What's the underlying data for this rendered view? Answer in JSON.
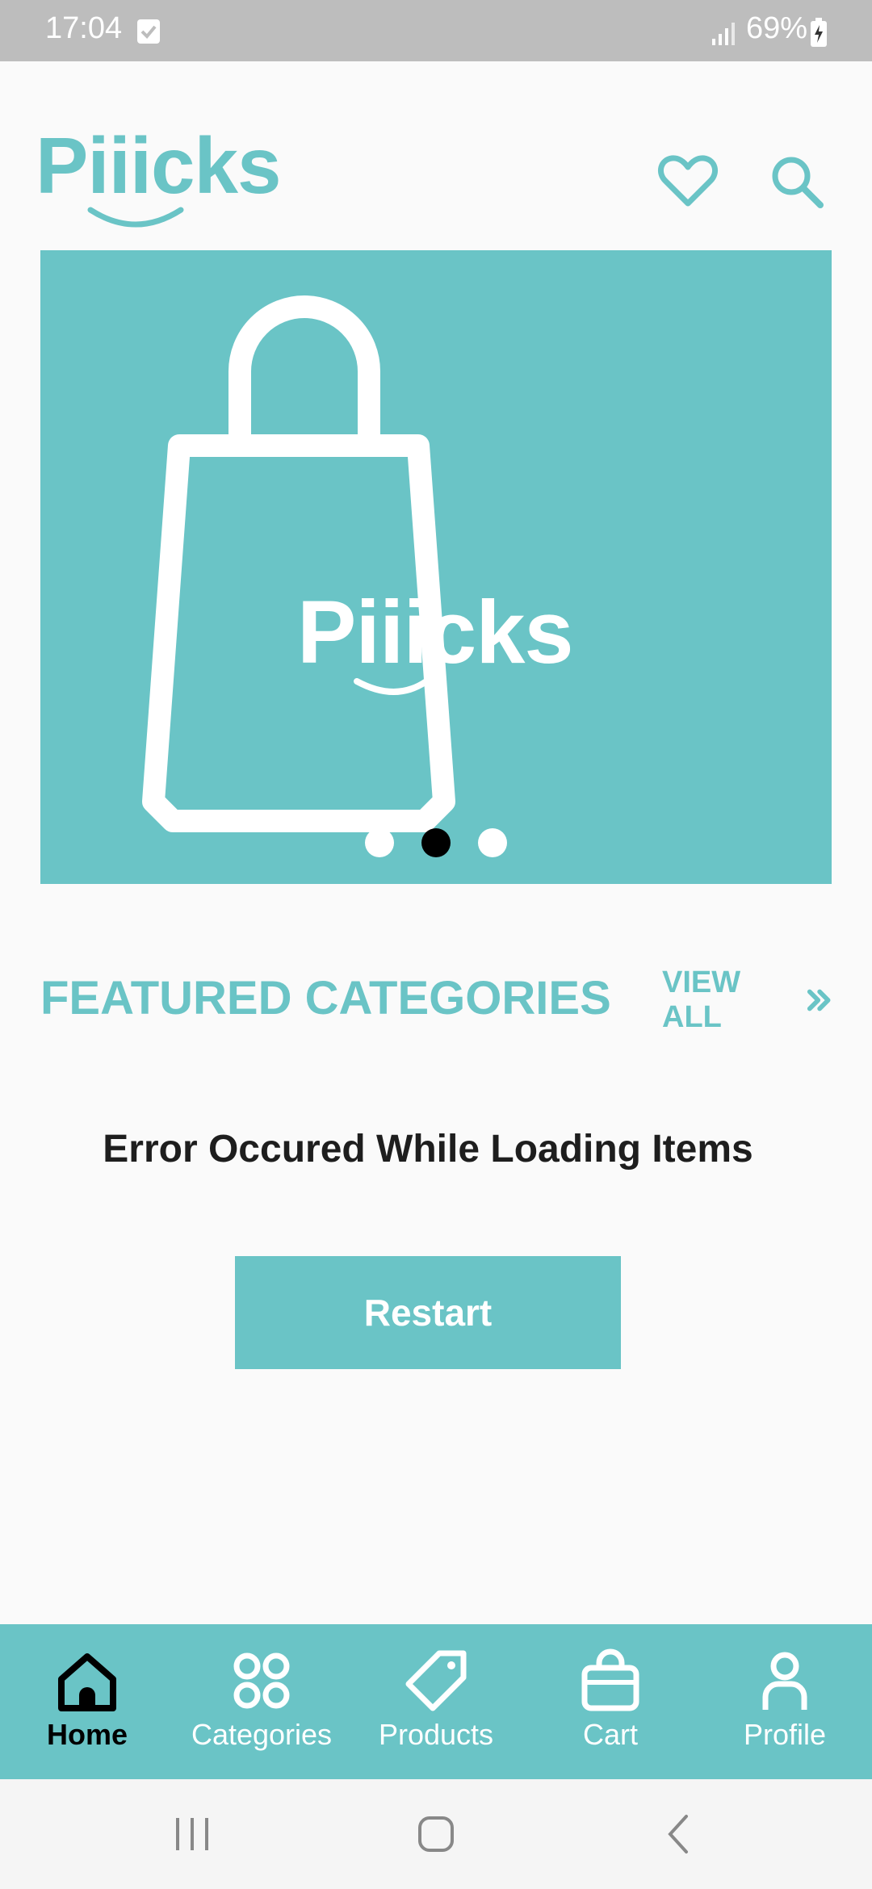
{
  "status_bar": {
    "time": "17:04",
    "battery": "69%",
    "icons": [
      "check-notification-icon",
      "signal-icon",
      "battery-charging-icon"
    ]
  },
  "header": {
    "logo_text": "Piiicks",
    "actions": [
      "heart-icon",
      "search-icon"
    ]
  },
  "banner": {
    "logo_text": "Piiicks",
    "slides_count": 3,
    "active_slide": 2,
    "background_color": "#6ac4c6"
  },
  "featured": {
    "title": "FEATURED CATEGORIES",
    "view_all_label": "VIEW ALL",
    "view_all_icon": "double-chevron-right-icon"
  },
  "error": {
    "message": "Error Occured While Loading Items",
    "button_label": "Restart"
  },
  "bottom_nav": {
    "items": [
      {
        "label": "Home",
        "icon": "home-icon",
        "active": true
      },
      {
        "label": "Categories",
        "icon": "categories-icon",
        "active": false
      },
      {
        "label": "Products",
        "icon": "tag-icon",
        "active": false
      },
      {
        "label": "Cart",
        "icon": "shopping-bag-icon",
        "active": false
      },
      {
        "label": "Profile",
        "icon": "profile-icon",
        "active": false
      }
    ]
  },
  "system_nav": {
    "icons": [
      "recent-apps-icon",
      "home-button-icon",
      "back-icon"
    ]
  },
  "theme": {
    "accent": "#6ac4c6",
    "background": "#fafafa",
    "status_bar": "#bdbdbd"
  }
}
